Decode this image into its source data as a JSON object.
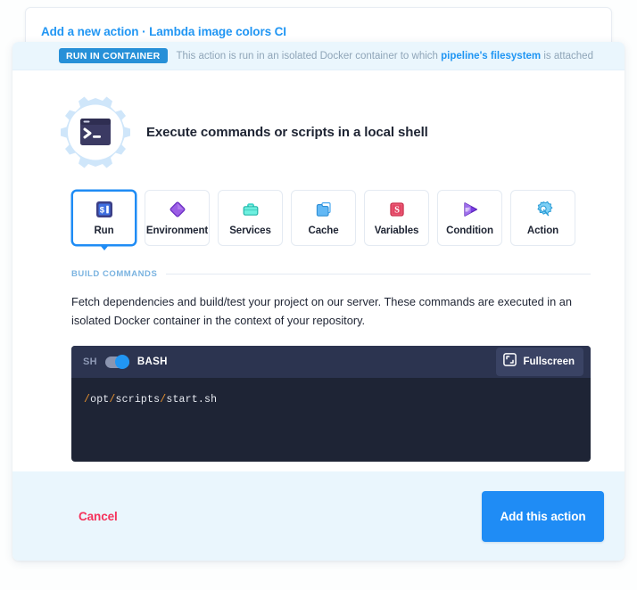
{
  "breadcrumb": {
    "text": "Add a new action · Lambda image colors CI"
  },
  "banner": {
    "pill_label": "RUN IN CONTAINER",
    "text_before": "This action is run in an isolated Docker container to which ",
    "link_label": "pipeline's filesystem",
    "text_after": " is attached"
  },
  "hero": {
    "icon": "terminal-gear-icon",
    "title": "Execute commands or scripts in a local shell"
  },
  "tabs": [
    {
      "label": "Run",
      "icon": "run-dollar-icon",
      "active": true
    },
    {
      "label": "Environment",
      "icon": "diamond-icon",
      "active": false
    },
    {
      "label": "Services",
      "icon": "toolbox-icon",
      "active": false
    },
    {
      "label": "Cache",
      "icon": "folder-icon",
      "active": false
    },
    {
      "label": "Variables",
      "icon": "dollar-square-icon",
      "active": false
    },
    {
      "label": "Condition",
      "icon": "if-play-icon",
      "active": false
    },
    {
      "label": "Action",
      "icon": "action-gear-icon",
      "active": false
    }
  ],
  "section": {
    "title": "BUILD COMMANDS",
    "description": "Fetch dependencies and build/test your project on our server. These commands are executed in an isolated Docker container in the context of your repository."
  },
  "terminal": {
    "toggle_left_label": "SH",
    "toggle_right_label": "BASH",
    "toggle_state": "BASH",
    "fullscreen_label": "Fullscreen",
    "fullscreen_icon": "fullscreen-icon",
    "command": "/opt/scripts/start.sh"
  },
  "footer": {
    "cancel_label": "Cancel",
    "submit_label": "Add this action"
  },
  "colors": {
    "accent_blue": "#1f8cf5",
    "link_blue": "#2196f3",
    "pill_blue": "#2790d8",
    "danger_red": "#f5325b",
    "banner_bg": "#eaf6fd",
    "terminal_bg": "#1e2435",
    "terminal_bar_bg": "#2c3450",
    "command_accent": "#e8922e"
  }
}
